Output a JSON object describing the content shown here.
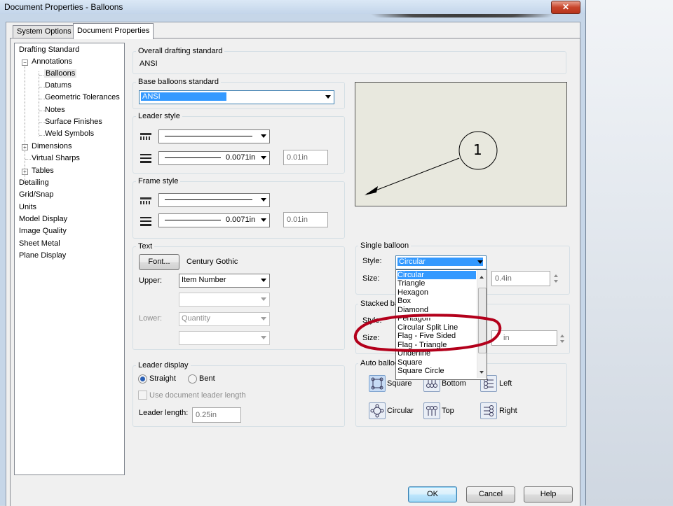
{
  "window": {
    "title": "Document Properties - Balloons",
    "close_glyph": "✕"
  },
  "tabs": [
    {
      "label": "System Options",
      "active": false
    },
    {
      "label": "Document Properties",
      "active": true
    }
  ],
  "tree": {
    "items": [
      {
        "label": "Drafting Standard"
      },
      {
        "label": "Annotations"
      },
      {
        "label": "Balloons",
        "selected": true
      },
      {
        "label": "Datums"
      },
      {
        "label": "Geometric Tolerances"
      },
      {
        "label": "Notes"
      },
      {
        "label": "Surface Finishes"
      },
      {
        "label": "Weld Symbols"
      },
      {
        "label": "Dimensions"
      },
      {
        "label": "Virtual Sharps"
      },
      {
        "label": "Tables"
      },
      {
        "label": "Detailing"
      },
      {
        "label": "Grid/Snap"
      },
      {
        "label": "Units"
      },
      {
        "label": "Model Display"
      },
      {
        "label": "Image Quality"
      },
      {
        "label": "Sheet Metal"
      },
      {
        "label": "Plane Display"
      }
    ]
  },
  "overall_standard": {
    "label": "Overall drafting standard",
    "value": "ANSI"
  },
  "base_standard": {
    "label": "Base balloons standard",
    "value": "ANSI"
  },
  "leader_style": {
    "label": "Leader style",
    "thickness": "0.0071in",
    "custom": "0.01in"
  },
  "frame_style": {
    "label": "Frame style",
    "thickness": "0.0071in",
    "custom": "0.01in"
  },
  "text": {
    "label": "Text",
    "font_button": "Font...",
    "font_name": "Century Gothic",
    "upper_label": "Upper:",
    "upper_value": "Item Number",
    "lower_label": "Lower:",
    "lower_value": "Quantity"
  },
  "leader_display": {
    "label": "Leader display",
    "straight": "Straight",
    "bent": "Bent",
    "use_doc_length": "Use document leader length",
    "length_label": "Leader length:",
    "length_value": "0.25in"
  },
  "preview": {
    "balloon_text": "1"
  },
  "single_balloon": {
    "label": "Single balloon",
    "style_label": "Style:",
    "style_value": "Circular",
    "size_label": "Size:",
    "size_value": "0.4in"
  },
  "stacked_balloons": {
    "label": "Stacked ba",
    "style_label": "Style:",
    "size_label": "Size:",
    "size_value": "in"
  },
  "style_dropdown": {
    "options": [
      "Circular",
      "Triangle",
      "Hexagon",
      "Box",
      "Diamond",
      "Pentagon",
      "Circular Split Line",
      "Flag - Five Sided",
      "Flag - Triangle",
      "Underline",
      "Square",
      "Square Circle"
    ],
    "selected": "Circular"
  },
  "auto_balloon": {
    "label": "Auto balloo",
    "square": "Square",
    "bottom": "Bottom",
    "left": "Left",
    "circular": "Circular",
    "top": "Top",
    "right": "Right"
  },
  "buttons": {
    "ok": "OK",
    "cancel": "Cancel",
    "help": "Help"
  },
  "colors": {
    "selection": "#3399ff",
    "annotation_red": "#b3001b"
  }
}
